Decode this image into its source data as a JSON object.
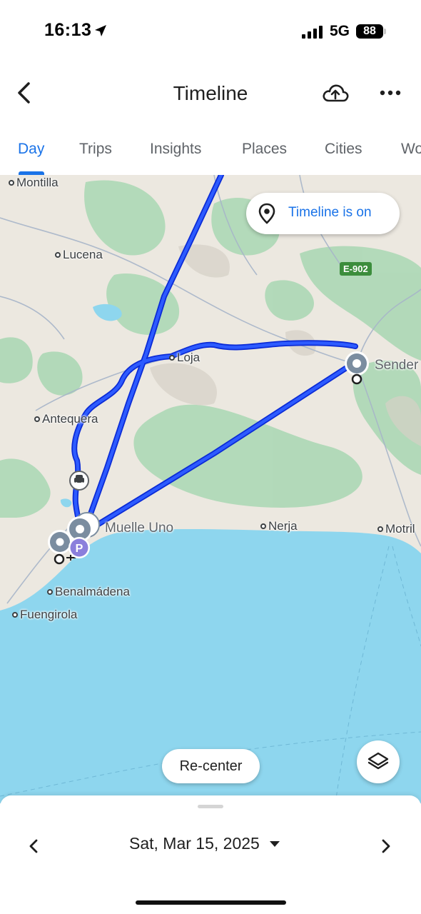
{
  "status_bar": {
    "time": "16:13",
    "network": "5G",
    "battery": "88"
  },
  "header": {
    "title": "Timeline",
    "icons": [
      "back-icon",
      "cloud-upload-icon",
      "more-horizontal-icon"
    ]
  },
  "tabs": [
    {
      "label": "Day",
      "active": true
    },
    {
      "label": "Trips",
      "active": false
    },
    {
      "label": "Insights",
      "active": false
    },
    {
      "label": "Places",
      "active": false
    },
    {
      "label": "Cities",
      "active": false
    },
    {
      "label": "Wo",
      "active": false
    }
  ],
  "map": {
    "timeline_chip": "Timeline is on",
    "road_shield": "E-902",
    "labels": {
      "montilla": "Montilla",
      "lucena": "Lucena",
      "loja": "Loja",
      "antequera": "Antequera",
      "sender": "Sender",
      "muelle_uno": "Muelle Uno",
      "nerja": "Nerja",
      "motril": "Motril",
      "benalmadena": "Benalmádena",
      "fuengirola": "Fuengirola"
    },
    "markers": {
      "parking": "P"
    },
    "recenter_label": "Re-center",
    "colors": {
      "route": "#1a3cff",
      "water": "#8ed6ee",
      "land": "#ece8e0",
      "terrain": "#a9d7b3"
    }
  },
  "bottom_sheet": {
    "date": "Sat, Mar 15, 2025"
  }
}
